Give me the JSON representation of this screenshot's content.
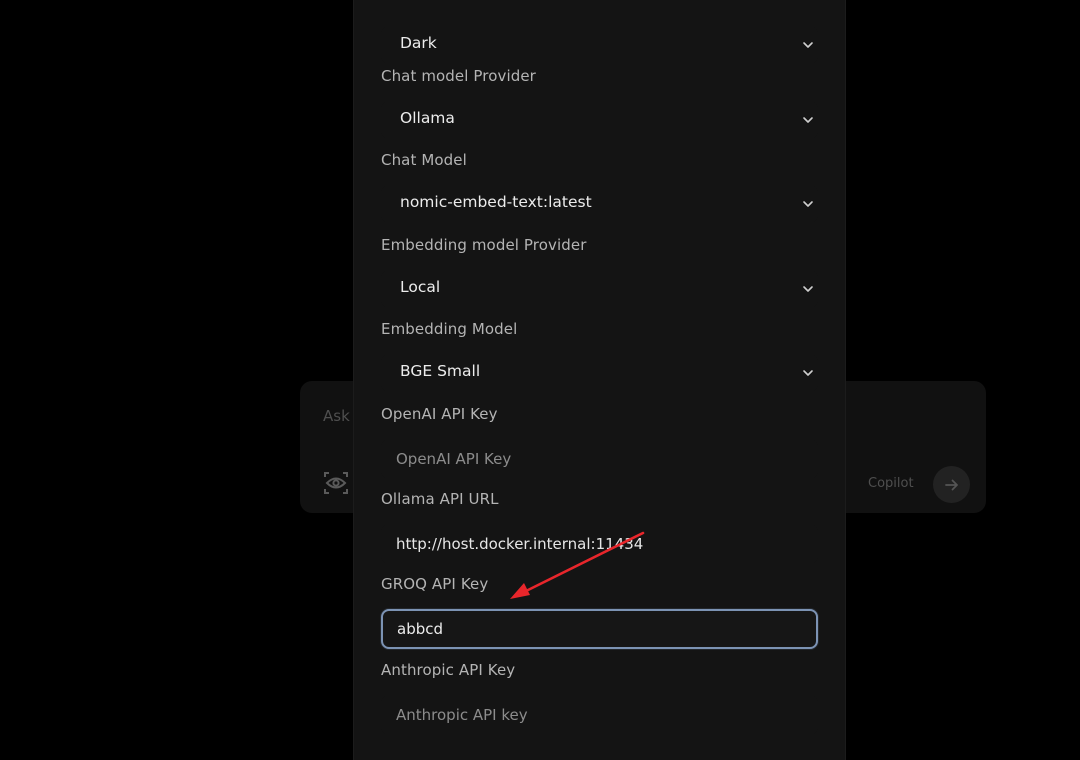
{
  "background": {
    "chat_placeholder": "Ask",
    "mode_label": "Copilot",
    "icons": {
      "vision": "eye-scan-icon",
      "send": "arrow-right-icon"
    }
  },
  "settings": {
    "fields": [
      {
        "label": "",
        "type": "select",
        "value": "Dark"
      },
      {
        "label": "Chat model Provider",
        "type": "select",
        "value": "Ollama"
      },
      {
        "label": "Chat Model",
        "type": "select",
        "value": "nomic-embed-text:latest"
      },
      {
        "label": "Embedding model Provider",
        "type": "select",
        "value": "Local"
      },
      {
        "label": "Embedding Model",
        "type": "select",
        "value": "BGE Small"
      },
      {
        "label": "OpenAI API Key",
        "type": "input",
        "value": "",
        "placeholder": "OpenAI API Key"
      },
      {
        "label": "Ollama API URL",
        "type": "input",
        "value": "http://host.docker.internal:11434",
        "placeholder": ""
      },
      {
        "label": "GROQ API Key",
        "type": "input",
        "value": "abbcd",
        "placeholder": "",
        "focused": true
      },
      {
        "label": "Anthropic API Key",
        "type": "input",
        "value": "",
        "placeholder": "Anthropic API key"
      }
    ]
  },
  "colors": {
    "page_background": "#000000",
    "modal_background": "#141414",
    "label_text": "#b4b4b4",
    "value_text": "#ececec",
    "placeholder_text": "#8c8c8c",
    "focus_border": "#7c93b4",
    "annotation_arrow": "#e8262b"
  }
}
